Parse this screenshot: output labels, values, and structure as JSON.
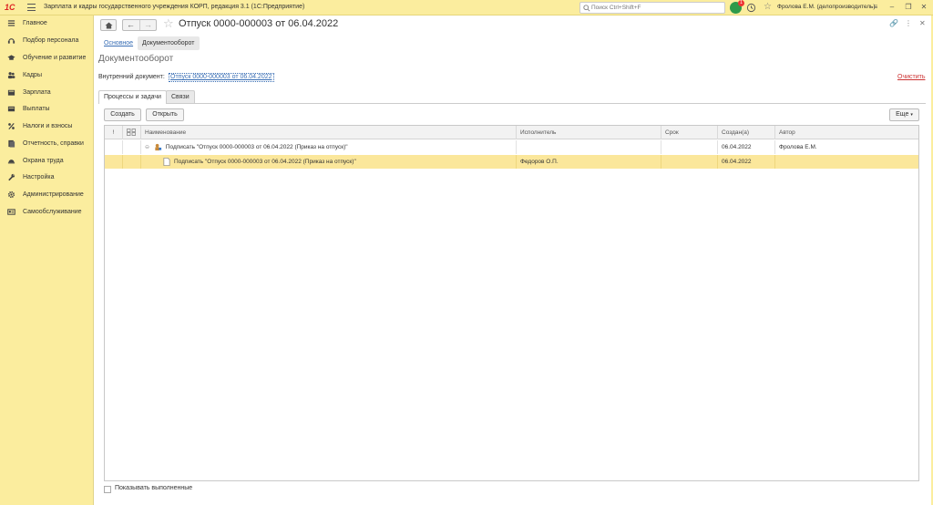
{
  "app": {
    "title": "Зарплата и кадры государственного учреждения КОРП, редакция 3.1  (1С:Предприятие)",
    "logo": "1С",
    "search_placeholder": "Поиск Ctrl+Shift+F",
    "notif_count": "1",
    "user": "Фролова Е.М. (делопроизводитель)"
  },
  "sidebar": {
    "items": [
      {
        "label": "Главное",
        "icon": "menu-lines-icon"
      },
      {
        "label": "Подбор персонала",
        "icon": "headset-icon"
      },
      {
        "label": "Обучение и развитие",
        "icon": "graduation-cap-icon"
      },
      {
        "label": "Кадры",
        "icon": "people-icon"
      },
      {
        "label": "Зарплата",
        "icon": "wallet-icon"
      },
      {
        "label": "Выплаты",
        "icon": "coins-icon"
      },
      {
        "label": "Налоги и взносы",
        "icon": "percent-icon"
      },
      {
        "label": "Отчетность, справки",
        "icon": "report-icon"
      },
      {
        "label": "Охрана труда",
        "icon": "helmet-icon"
      },
      {
        "label": "Настройка",
        "icon": "wrench-icon"
      },
      {
        "label": "Администрирование",
        "icon": "gear-icon"
      },
      {
        "label": "Самообслуживание",
        "icon": "id-card-icon"
      }
    ]
  },
  "document": {
    "title": "Отпуск 0000-000003 от 06.04.2022",
    "subtabs": [
      "Основное",
      "Документооборот"
    ],
    "section_title": "Документооборот",
    "internal_doc_label": "Внутренний документ:",
    "internal_doc_value": "Отпуск 0000-000003 от 06.04.2022",
    "clear_label": "Очистить",
    "panel_tabs": [
      "Процессы и задачи",
      "Связи"
    ],
    "buttons": {
      "create": "Создать",
      "open": "Открыть",
      "more": "Еще"
    },
    "grid": {
      "columns": [
        "!",
        "",
        "Наименование",
        "Исполнитель",
        "Срок",
        "Создан(а)",
        "Автор"
      ],
      "rows": [
        {
          "name": "Подписать \"Отпуск 0000-000003 от 06.04.2022 (Приказ на отпуск)\"",
          "executor": "",
          "deadline": "",
          "created": "06.04.2022",
          "author": "Фролова Е.М.",
          "level": 0
        },
        {
          "name": "Подписать \"Отпуск 0000-000003 от 06.04.2022 (Приказ на отпуск)\"",
          "executor": "Федоров О.П.",
          "deadline": "",
          "created": "06.04.2022",
          "author": "",
          "level": 1
        }
      ]
    },
    "show_completed_label": "Показывать выполненные"
  },
  "colors": {
    "panel": "#fbed9e",
    "selection": "#fbe79b",
    "link": "#3a6fb5",
    "clear": "#cc3333"
  }
}
